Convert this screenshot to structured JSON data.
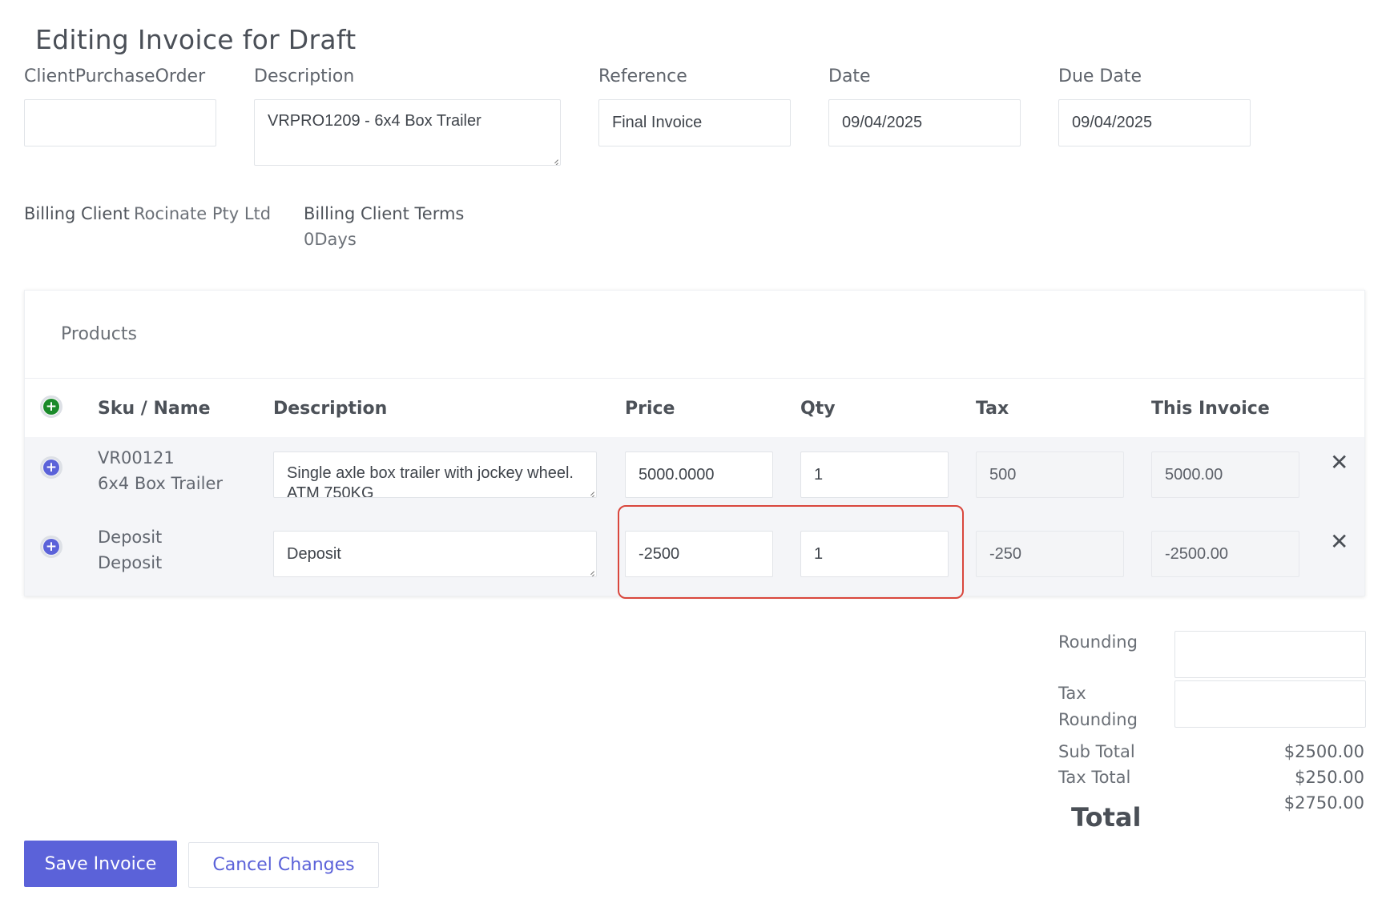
{
  "page_title": "Editing Invoice for Draft",
  "fields": {
    "client_po": {
      "label": "ClientPurchaseOrder",
      "value": ""
    },
    "description": {
      "label": "Description",
      "value": "VRPRO1209 - 6x4 Box Trailer"
    },
    "reference": {
      "label": "Reference",
      "value": "Final Invoice"
    },
    "date": {
      "label": "Date",
      "value": "09/04/2025"
    },
    "due_date": {
      "label": "Due Date",
      "value": "09/04/2025"
    }
  },
  "billing": {
    "client_label": "Billing Client",
    "client_value": "Rocinate Pty Ltd",
    "terms_label": "Billing Client Terms",
    "terms_value": "0Days"
  },
  "products": {
    "title": "Products",
    "headers": {
      "sku_name": "Sku / Name",
      "description": "Description",
      "price": "Price",
      "qty": "Qty",
      "tax": "Tax",
      "this_invoice": "This Invoice"
    },
    "rows": [
      {
        "sku": "VR00121",
        "name": "6x4 Box Trailer",
        "description": "Single axle box trailer with jockey wheel. ATM 750KG",
        "price": "5000.0000",
        "qty": "1",
        "tax": "500",
        "this_invoice": "5000.00"
      },
      {
        "sku": "Deposit",
        "name": "Deposit",
        "description": "Deposit",
        "price": "-2500",
        "qty": "1",
        "tax": "-250",
        "this_invoice": "-2500.00"
      }
    ]
  },
  "totals": {
    "rounding_label": "Rounding",
    "rounding_value": "",
    "tax_rounding_label_1": "Tax",
    "tax_rounding_label_2": "Rounding",
    "tax_rounding_value": "",
    "sub_total_label": "Sub Total",
    "sub_total_value": "$2500.00",
    "tax_total_label": "Tax Total",
    "tax_total_value": "$250.00",
    "total_label": "Total",
    "total_value": "$2750.00"
  },
  "actions": {
    "save": "Save Invoice",
    "cancel": "Cancel Changes"
  },
  "colors": {
    "primary": "#5b62d9",
    "add_icon": "#1a8a2a",
    "row_icon": "#5b62d9",
    "highlight": "#d9473d"
  },
  "icons": {
    "add_product": "plus-circle-icon",
    "row_expand": "plus-circle-icon",
    "remove_row": "close-icon"
  }
}
